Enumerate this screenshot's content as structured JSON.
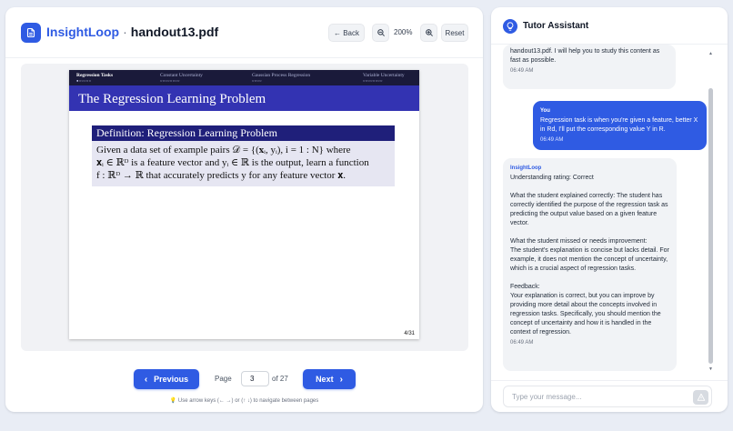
{
  "app": {
    "name": "InsightLoop",
    "separator": "·",
    "file": "handout13.pdf"
  },
  "toolbar": {
    "back_label": "← Back",
    "zoom": "200%",
    "reset_label": "Reset"
  },
  "slide": {
    "nav": [
      {
        "label": "Regression Tasks",
        "dots": "●○○○○○"
      },
      {
        "label": "Constant Uncertainty",
        "dots": "○○○○○○○○"
      },
      {
        "label": "Gaussian Process Regression",
        "dots": "○○○○"
      },
      {
        "label": "Variable Uncertainty",
        "dots": "○○○○○○○○"
      }
    ],
    "title": "The Regression Learning Problem",
    "definition_head": "Definition: Regression Learning Problem",
    "definition_lines": [
      "Given a data set of example pairs 𝒟 = {(𝐱ᵢ, yᵢ), i = 1 : N} where",
      "𝐱ᵢ ∈ ℝᴰ is a feature vector and yᵢ ∈ ℝ is the output, learn a function",
      "f : ℝᴰ → ℝ that accurately predicts y for any feature vector 𝐱."
    ],
    "page_indicator": "4/31"
  },
  "pagination": {
    "prev_label": "Previous",
    "page_label": "Page",
    "current_page": "3",
    "of_label": "of 27",
    "next_label": "Next",
    "hint": "Use arrow keys (← →) or (↑ ↓) to navigate between pages"
  },
  "chat": {
    "title": "Tutor Assistant",
    "messages": [
      {
        "sender": "",
        "text": "handout13.pdf. I will help you to study this content as fast as possible.",
        "time": "06:49 AM"
      },
      {
        "sender": "You",
        "text": "Regression task is when you're given a feature, better X in Rd, I'll put the corresponding value Y in R.",
        "time": "06:49 AM"
      },
      {
        "sender": "InsightLoop",
        "text": "Understanding rating: Correct\n\nWhat the student explained correctly: The student has correctly identified the purpose of the regression task as predicting the output value based on a given feature vector.\n\nWhat the student missed or needs improvement:\nThe student's explanation is concise but lacks detail. For example, it does not mention the concept of uncertainty, which is a crucial aspect of regression tasks.\n\nFeedback:\nYour explanation is correct, but you can improve by providing more detail about the concepts involved in regression tasks. Specifically, you should mention the concept of uncertainty and how it is handled in the context of regression.",
        "time": "06:49 AM"
      }
    ],
    "input_placeholder": "Type your message..."
  },
  "colors": {
    "accent": "#2f5be3",
    "slide_nav": "#1a1a3a",
    "slide_title_bar": "#3333b2",
    "definition_head": "#1f1f7a",
    "definition_body": "#e6e6f2"
  },
  "icons": {
    "logo": "document-icon",
    "zoom_out": "zoom-out-icon",
    "zoom_in": "zoom-in-icon",
    "chat": "lightbulb-icon",
    "send": "send-icon",
    "hint": "lightbulb-icon"
  }
}
